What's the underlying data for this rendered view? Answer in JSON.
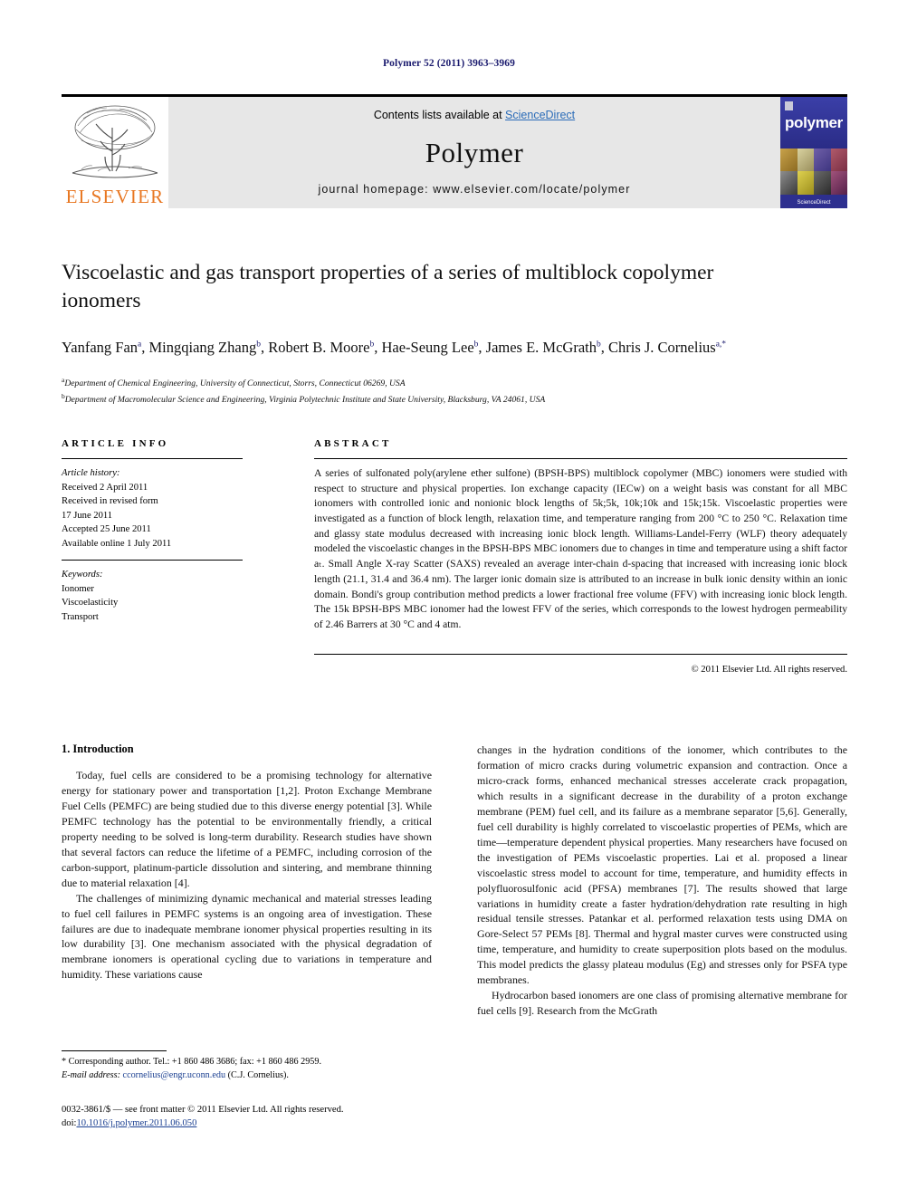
{
  "running_head": "Polymer 52 (2011) 3963–3969",
  "masthead": {
    "contents_prefix": "Contents lists available at ",
    "sciencedirect": "ScienceDirect",
    "journal_name": "Polymer",
    "homepage": "journal homepage: www.elsevier.com/locate/polymer",
    "publisher_logo_text": "ELSEVIER",
    "cover_title": "polymer",
    "cover_footer": "ScienceDirect",
    "accent_orange": "#E87722",
    "accent_link": "#2b6cb8",
    "cover_blue": "#2d2f8f"
  },
  "article": {
    "title": "Viscoelastic and gas transport properties of a series of multiblock copolymer ionomers",
    "authors_line1": "Yanfang Fan",
    "authors": [
      {
        "name": "Yanfang Fan",
        "sup": "a"
      },
      {
        "name": "Mingqiang Zhang",
        "sup": "b"
      },
      {
        "name": "Robert B. Moore",
        "sup": "b"
      },
      {
        "name": "Hae-Seung Lee",
        "sup": "b"
      },
      {
        "name": "James E. McGrath",
        "sup": "b"
      },
      {
        "name": "Chris J. Cornelius",
        "sup": "a,*"
      }
    ],
    "affiliations": [
      {
        "mark": "a",
        "text": "Department of Chemical Engineering, University of Connecticut, Storrs, Connecticut 06269, USA"
      },
      {
        "mark": "b",
        "text": "Department of Macromolecular Science and Engineering, Virginia Polytechnic Institute and State University, Blacksburg, VA 24061, USA"
      }
    ]
  },
  "article_info": {
    "heading": "ARTICLE INFO",
    "history_label": "Article history:",
    "history": [
      "Received 2 April 2011",
      "Received in revised form",
      "17 June 2011",
      "Accepted 25 June 2011",
      "Available online 1 July 2011"
    ],
    "keywords_label": "Keywords:",
    "keywords": [
      "Ionomer",
      "Viscoelasticity",
      "Transport"
    ]
  },
  "abstract": {
    "heading": "ABSTRACT",
    "text": "A series of sulfonated poly(arylene ether sulfone) (BPSH-BPS) multiblock copolymer (MBC) ionomers were studied with respect to structure and physical properties. Ion exchange capacity (IECw) on a weight basis was constant for all MBC ionomers with controlled ionic and nonionic block lengths of 5k;5k, 10k;10k and 15k;15k. Viscoelastic properties were investigated as a function of block length, relaxation time, and temperature ranging from 200 °C to 250 °C. Relaxation time and glassy state modulus decreased with increasing ionic block length. Williams-Landel-Ferry (WLF) theory adequately modeled the viscoelastic changes in the BPSH-BPS MBC ionomers due to changes in time and temperature using a shift factor aₜ. Small Angle X-ray Scatter (SAXS) revealed an average inter-chain d-spacing that increased with increasing ionic block length (21.1, 31.4 and 36.4 nm). The larger ionic domain size is attributed to an increase in bulk ionic density within an ionic domain. Bondi's group contribution method predicts a lower fractional free volume (FFV) with increasing ionic block length. The 15k BPSH-BPS MBC ionomer had the lowest FFV of the series, which corresponds to the lowest hydrogen permeability of 2.46 Barrers at 30 °C and 4 atm.",
    "copyright": "© 2011 Elsevier Ltd. All rights reserved."
  },
  "body": {
    "section_number_title": "1.  Introduction",
    "left_paragraph_1": "Today, fuel cells are considered to be a promising technology for alternative energy for stationary power and transportation [1,2]. Proton Exchange Membrane Fuel Cells (PEMFC) are being studied due to this diverse energy potential [3]. While PEMFC technology has the potential to be environmentally friendly, a critical property needing to be solved is long-term durability. Research studies have shown that several factors can reduce the lifetime of a PEMFC, including corrosion of the carbon-support, platinum-particle dissolution and sintering, and membrane thinning due to material relaxation [4].",
    "left_paragraph_2": "The challenges of minimizing dynamic mechanical and material stresses leading to fuel cell failures in PEMFC systems is an ongoing area of investigation. These failures are due to inadequate membrane ionomer physical properties resulting in its low durability [3]. One mechanism associated with the physical degradation of membrane ionomers is operational cycling due to variations in temperature and humidity. These variations cause",
    "right_paragraph_1": "changes in the hydration conditions of the ionomer, which contributes to the formation of micro cracks during volumetric expansion and contraction. Once a micro-crack forms, enhanced mechanical stresses accelerate crack propagation, which results in a significant decrease in the durability of a proton exchange membrane (PEM) fuel cell, and its failure as a membrane separator [5,6]. Generally, fuel cell durability is highly correlated to viscoelastic properties of PEMs, which are time—temperature dependent physical properties. Many researchers have focused on the investigation of PEMs viscoelastic properties. Lai et al. proposed a linear viscoelastic stress model to account for time, temperature, and humidity effects in polyfluorosulfonic acid (PFSA) membranes [7]. The results showed that large variations in humidity create a faster hydration/dehydration rate resulting in high residual tensile stresses. Patankar et al. performed relaxation tests using DMA on Gore-Select 57 PEMs [8]. Thermal and hygral master curves were constructed using time, temperature, and humidity to create superposition plots based on the modulus. This model predicts the glassy plateau modulus (Eg) and stresses only for PSFA type membranes.",
    "right_paragraph_2": "Hydrocarbon based ionomers are one class of promising alternative membrane for fuel cells [9]. Research from the McGrath"
  },
  "footnote": {
    "corresponding": "* Corresponding author. Tel.: +1 860 486 3686; fax: +1 860 486 2959.",
    "email_label": "E-mail address:",
    "email": "ccornelius@engr.uconn.edu",
    "email_person": "(C.J. Cornelius)."
  },
  "footer": {
    "issn_line": "0032-3861/$ — see front matter © 2011 Elsevier Ltd. All rights reserved.",
    "doi_label": "doi:",
    "doi": "10.1016/j.polymer.2011.06.050"
  }
}
